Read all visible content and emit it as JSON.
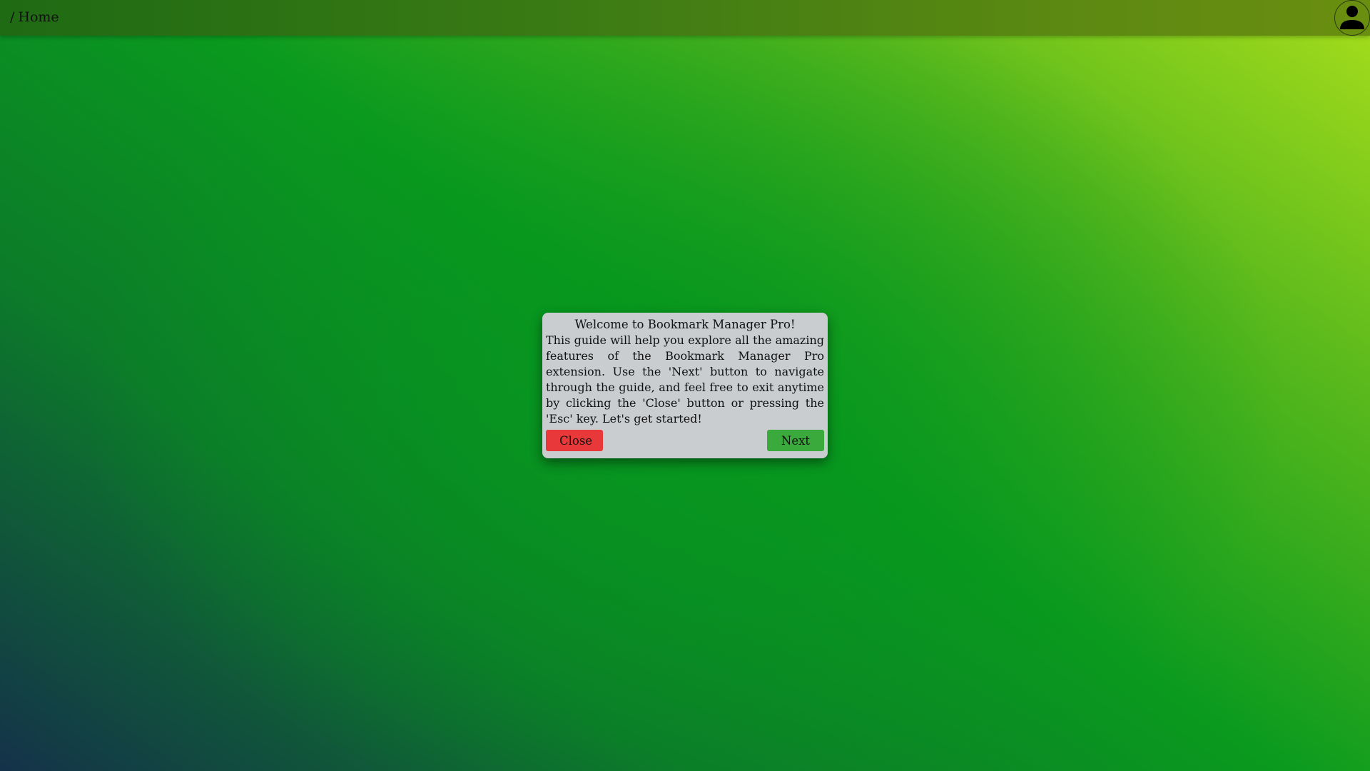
{
  "header": {
    "breadcrumb_separator": "/",
    "breadcrumb_current": "Home",
    "avatar_icon": "user-icon"
  },
  "dialog": {
    "title": "Welcome to Bookmark Manager Pro!",
    "body": "This guide will help you explore all the amazing features of the Bookmark Manager Pro extension. Use the 'Next' button to navigate through the guide, and feel free to exit anytime by clicking the 'Close' button or pressing the 'Esc' key. Let's get started!",
    "close_label": "Close",
    "next_label": "Next"
  },
  "colors": {
    "close_button": "#e8383a",
    "next_button": "#3aaa3c",
    "dialog_background": "#c9cdd0"
  }
}
